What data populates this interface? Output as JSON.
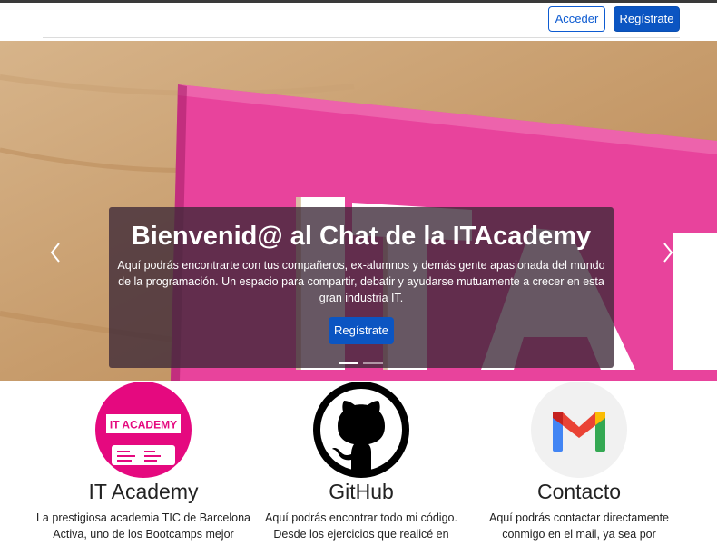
{
  "header": {
    "login_label": "Acceder",
    "register_label": "Regístrate"
  },
  "hero": {
    "title": "Bienvenid@ al Chat de la ITAcademy",
    "description": "Aquí podrás encontrarte con tus compañeros, ex-alumnos y demás gente apasionada del mundo de la programación. Un espacio para compartir, debatir y ayudarse mutuamente a crecer en esta gran industria IT.",
    "button_label": "Regístrate",
    "slide_count": 2,
    "active_slide": 1,
    "background_sign_text": "IT AC"
  },
  "features": [
    {
      "title": "IT Academy",
      "logo_text": "IT ACADEMY",
      "description": "La prestigiosa academia TIC de Barcelona Activa, uno de los Bootcamps mejor"
    },
    {
      "title": "GitHub",
      "description": "Aquí podrás encontrar todo mi código. Desde los ejercicios que realicé en"
    },
    {
      "title": "Contacto",
      "description": "Aquí podrás contactar directamente conmigo en el mail, ya sea por"
    }
  ],
  "colors": {
    "primary": "#0b55c2",
    "itacademy_pink": "#e5097f",
    "caption_bg": "#3c2837"
  }
}
